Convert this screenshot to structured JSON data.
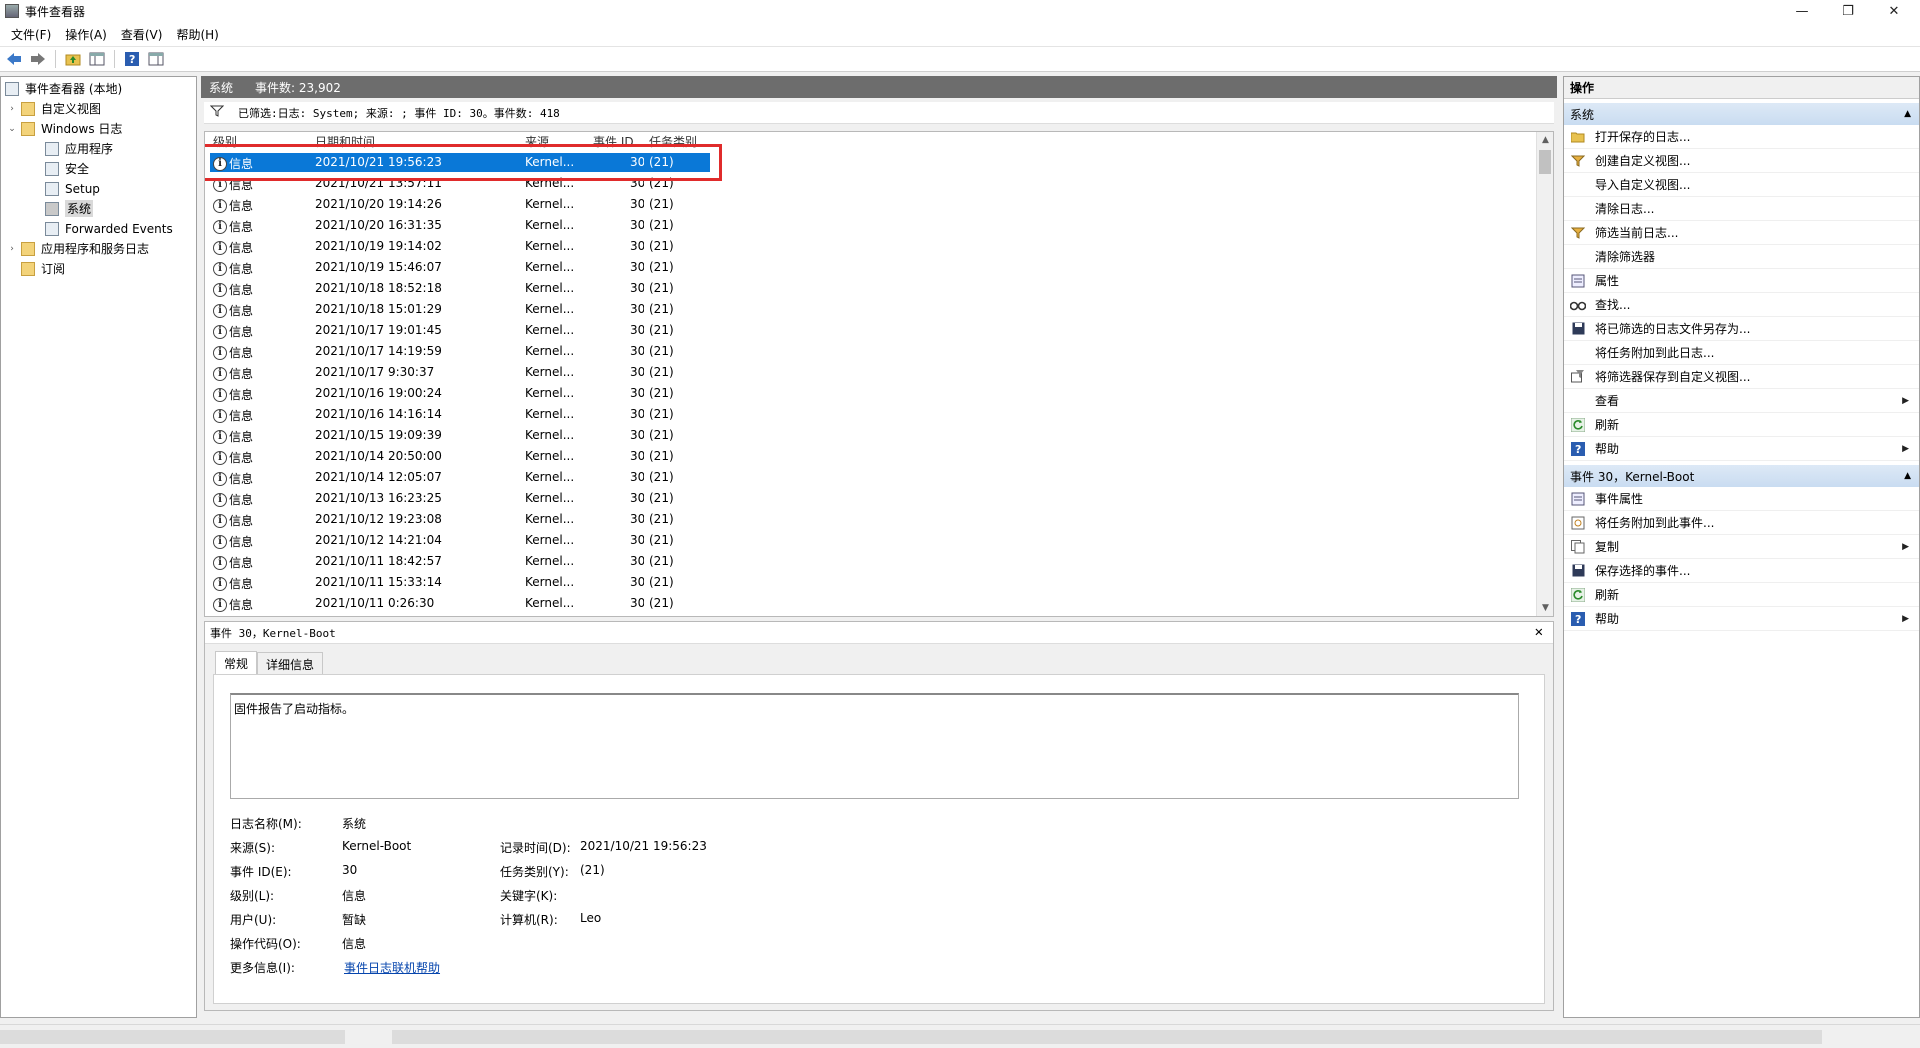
{
  "window": {
    "title": "事件查看器",
    "minimize": "—",
    "restore": "❐",
    "close": "✕"
  },
  "menu": [
    "文件(F)",
    "操作(A)",
    "查看(V)",
    "帮助(H)"
  ],
  "tree": {
    "root": "事件查看器 (本地)",
    "custom_views": "自定义视图",
    "windows_logs": "Windows 日志",
    "application": "应用程序",
    "security": "安全",
    "setup": "Setup",
    "system": "系统",
    "forwarded": "Forwarded Events",
    "app_service_logs": "应用程序和服务日志",
    "subscriptions": "订阅"
  },
  "panel": {
    "title": "系统",
    "count": "事件数: 23,902"
  },
  "filter": "已筛选:日志: System; 来源: ; 事件 ID: 30。事件数: 418",
  "columns": {
    "level": "级别",
    "datetime": "日期和时间",
    "source": "来源",
    "event_id": "事件 ID",
    "task": "任务类别"
  },
  "rows": [
    {
      "level": "信息",
      "datetime": "2021/10/21 19:56:23",
      "source": "Kernel...",
      "id": "30",
      "task": "(21)"
    },
    {
      "level": "信息",
      "datetime": "2021/10/21 13:57:11",
      "source": "Kernel...",
      "id": "30",
      "task": "(21)"
    },
    {
      "level": "信息",
      "datetime": "2021/10/20 19:14:26",
      "source": "Kernel...",
      "id": "30",
      "task": "(21)"
    },
    {
      "level": "信息",
      "datetime": "2021/10/20 16:31:35",
      "source": "Kernel...",
      "id": "30",
      "task": "(21)"
    },
    {
      "level": "信息",
      "datetime": "2021/10/19 19:14:02",
      "source": "Kernel...",
      "id": "30",
      "task": "(21)"
    },
    {
      "level": "信息",
      "datetime": "2021/10/19 15:46:07",
      "source": "Kernel...",
      "id": "30",
      "task": "(21)"
    },
    {
      "level": "信息",
      "datetime": "2021/10/18 18:52:18",
      "source": "Kernel...",
      "id": "30",
      "task": "(21)"
    },
    {
      "level": "信息",
      "datetime": "2021/10/18 15:01:29",
      "source": "Kernel...",
      "id": "30",
      "task": "(21)"
    },
    {
      "level": "信息",
      "datetime": "2021/10/17 19:01:45",
      "source": "Kernel...",
      "id": "30",
      "task": "(21)"
    },
    {
      "level": "信息",
      "datetime": "2021/10/17 14:19:59",
      "source": "Kernel...",
      "id": "30",
      "task": "(21)"
    },
    {
      "level": "信息",
      "datetime": "2021/10/17 9:30:37",
      "source": "Kernel...",
      "id": "30",
      "task": "(21)"
    },
    {
      "level": "信息",
      "datetime": "2021/10/16 19:00:24",
      "source": "Kernel...",
      "id": "30",
      "task": "(21)"
    },
    {
      "level": "信息",
      "datetime": "2021/10/16 14:16:14",
      "source": "Kernel...",
      "id": "30",
      "task": "(21)"
    },
    {
      "level": "信息",
      "datetime": "2021/10/15 19:09:39",
      "source": "Kernel...",
      "id": "30",
      "task": "(21)"
    },
    {
      "level": "信息",
      "datetime": "2021/10/14 20:50:00",
      "source": "Kernel...",
      "id": "30",
      "task": "(21)"
    },
    {
      "level": "信息",
      "datetime": "2021/10/14 12:05:07",
      "source": "Kernel...",
      "id": "30",
      "task": "(21)"
    },
    {
      "level": "信息",
      "datetime": "2021/10/13 16:23:25",
      "source": "Kernel...",
      "id": "30",
      "task": "(21)"
    },
    {
      "level": "信息",
      "datetime": "2021/10/12 19:23:08",
      "source": "Kernel...",
      "id": "30",
      "task": "(21)"
    },
    {
      "level": "信息",
      "datetime": "2021/10/12 14:21:04",
      "source": "Kernel...",
      "id": "30",
      "task": "(21)"
    },
    {
      "level": "信息",
      "datetime": "2021/10/11 18:42:57",
      "source": "Kernel...",
      "id": "30",
      "task": "(21)"
    },
    {
      "level": "信息",
      "datetime": "2021/10/11 15:33:14",
      "source": "Kernel...",
      "id": "30",
      "task": "(21)"
    },
    {
      "level": "信息",
      "datetime": "2021/10/11 0:26:30",
      "source": "Kernel...",
      "id": "30",
      "task": "(21)"
    }
  ],
  "detail": {
    "header": "事件 30，Kernel-Boot",
    "tab_general": "常规",
    "tab_details": "详细信息",
    "description": "固件报告了启动指标。",
    "labels": {
      "log_name": "日志名称(M):",
      "source": "来源(S):",
      "event_id": "事件 ID(E):",
      "level": "级别(L):",
      "user": "用户(U):",
      "opcode": "操作代码(O):",
      "more_info": "更多信息(I):",
      "logged": "记录时间(D):",
      "task": "任务类别(Y):",
      "keywords": "关键字(K):",
      "computer": "计算机(R):"
    },
    "values": {
      "log_name": "系统",
      "source": "Kernel-Boot",
      "event_id": "30",
      "level": "信息",
      "user": "暂缺",
      "opcode": "信息",
      "more_info": "事件日志联机帮助",
      "logged": "2021/10/21 19:56:23",
      "task": "(21)",
      "computer": "Leo"
    }
  },
  "actions": {
    "title": "操作",
    "section1": "系统",
    "items1": [
      {
        "label": "打开保存的日志...",
        "icon": "folder-open-icon",
        "submenu": false
      },
      {
        "label": "创建自定义视图...",
        "icon": "filter-icon",
        "submenu": false
      },
      {
        "label": "导入自定义视图...",
        "icon": "",
        "submenu": false
      },
      {
        "label": "清除日志...",
        "icon": "",
        "submenu": false
      },
      {
        "label": "筛选当前日志...",
        "icon": "filter-icon",
        "submenu": false
      },
      {
        "label": "清除筛选器",
        "icon": "",
        "submenu": false
      },
      {
        "label": "属性",
        "icon": "properties-icon",
        "submenu": false
      },
      {
        "label": "查找...",
        "icon": "find-icon",
        "submenu": false
      },
      {
        "label": "将已筛选的日志文件另存为...",
        "icon": "save-icon",
        "submenu": false
      },
      {
        "label": "将任务附加到此日志...",
        "icon": "",
        "submenu": false
      },
      {
        "label": "将筛选器保存到自定义视图...",
        "icon": "save-filter-icon",
        "submenu": false
      },
      {
        "label": "查看",
        "icon": "",
        "submenu": true
      },
      {
        "label": "刷新",
        "icon": "refresh-icon",
        "submenu": false
      },
      {
        "label": "帮助",
        "icon": "help-icon",
        "submenu": true
      }
    ],
    "section2": "事件 30，Kernel-Boot",
    "items2": [
      {
        "label": "事件属性",
        "icon": "properties-icon",
        "submenu": false
      },
      {
        "label": "将任务附加到此事件...",
        "icon": "task-icon",
        "submenu": false
      },
      {
        "label": "复制",
        "icon": "copy-icon",
        "submenu": true
      },
      {
        "label": "保存选择的事件...",
        "icon": "save-icon",
        "submenu": false
      },
      {
        "label": "刷新",
        "icon": "refresh-icon",
        "submenu": false
      },
      {
        "label": "帮助",
        "icon": "help-icon",
        "submenu": true
      }
    ]
  }
}
